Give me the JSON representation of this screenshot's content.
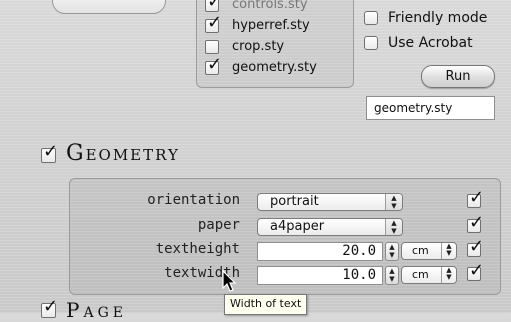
{
  "packages": {
    "items": [
      {
        "label": "controls.sty",
        "checked": true
      },
      {
        "label": "hyperref.sty",
        "checked": true
      },
      {
        "label": "crop.sty",
        "checked": false
      },
      {
        "label": "geometry.sty",
        "checked": true
      }
    ]
  },
  "options": {
    "friendly_mode": "Friendly mode",
    "use_acrobat": "Use Acrobat",
    "run_label": "Run",
    "selected_package": "geometry.sty"
  },
  "geometry": {
    "title": "Geometry",
    "rows": [
      {
        "label": "orientation",
        "value": "portrait"
      },
      {
        "label": "paper",
        "value": "a4paper"
      },
      {
        "label": "textheight",
        "value": "20.0",
        "unit": "cm"
      },
      {
        "label": "textwidth",
        "value": "10.0",
        "unit": "cm"
      }
    ]
  },
  "tooltip": "Width of text",
  "next_section": {
    "title": "Page"
  },
  "check_glyph": "✓"
}
